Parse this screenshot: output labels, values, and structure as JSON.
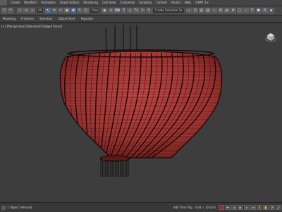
{
  "menu": {
    "items": [
      "Create",
      "Modifiers",
      "Animation",
      "Graph Editors",
      "Rendering",
      "Civil View",
      "Customize",
      "Scripting",
      "Content",
      "Arnold",
      "Help",
      "V-RAY 3.x"
    ]
  },
  "toolbar": {
    "selection_filter": "All",
    "view_dropdown": "View",
    "named_selection": "Create Selection Se"
  },
  "subbar": {
    "items": [
      "Modeling",
      "Freeform",
      "Selection",
      "Object Paint",
      "Populate"
    ]
  },
  "viewport": {
    "label": "[+] [Perspective] [Standard] [Edged Faces]"
  },
  "status": {
    "selection_text": "1 Object Selected",
    "grid_text": "Grid = 10.0cm",
    "time_tag": "Add Time Tag",
    "auto_key_label": "Auto Key",
    "set_key_label": "Set Key"
  },
  "colors": {
    "lamp_fill": "#b2413f",
    "wire": "#1a0606",
    "viewport_bg": "#3d3d3d"
  }
}
